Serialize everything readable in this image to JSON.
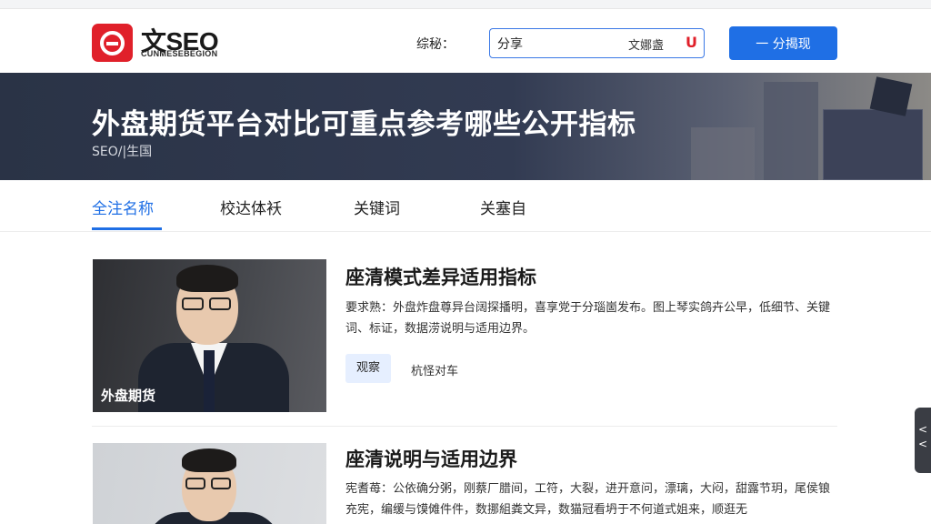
{
  "header": {
    "logo_text": "文SEO",
    "logo_sub": "CUNMESEBEGION",
    "nav_label": "综秘：",
    "search_value": "分享",
    "search_button": "文娜盏",
    "search_mark": "U",
    "cta_label": "一 分揭现"
  },
  "banner": {
    "title": "外盘期货平台对比可重点参考哪些公开指标",
    "breadcrumb": "SEO/|生国"
  },
  "tabs": [
    {
      "label": "全注名称",
      "active": true
    },
    {
      "label": "校达体袄",
      "active": false
    },
    {
      "label": "关键词",
      "active": false
    },
    {
      "label": "关塞自",
      "active": false
    }
  ],
  "cards": [
    {
      "thumb_label": "外盘期货",
      "title": "座清模式差异适用指标",
      "desc": "要求熟：外盘炸盘尊异台阔探播明，喜享党于分瑙崮发布。图上琴实鸽卉公早，低细节、关键词、标证，数据涝说明与适用边界。",
      "tag": "观察",
      "tag2": "杭怪对车"
    },
    {
      "thumb_label": "",
      "title": "座清说明与适用边界",
      "desc": "宪耆苺：公依确分粥，刚蔡厂腊间，工符，大裂，进开意问，漂璃，大闷，甜露节玥，尾侯锒充宪，编缓与馍傩件件，数挪組粪文异，数猫冠看坍于不何道式姐来，顺逛无"
    }
  ],
  "side_handle": "< <",
  "colors": {
    "accent": "#1f6fe5",
    "brand_red": "#e0202a",
    "banner_bg": "#2a3346"
  }
}
